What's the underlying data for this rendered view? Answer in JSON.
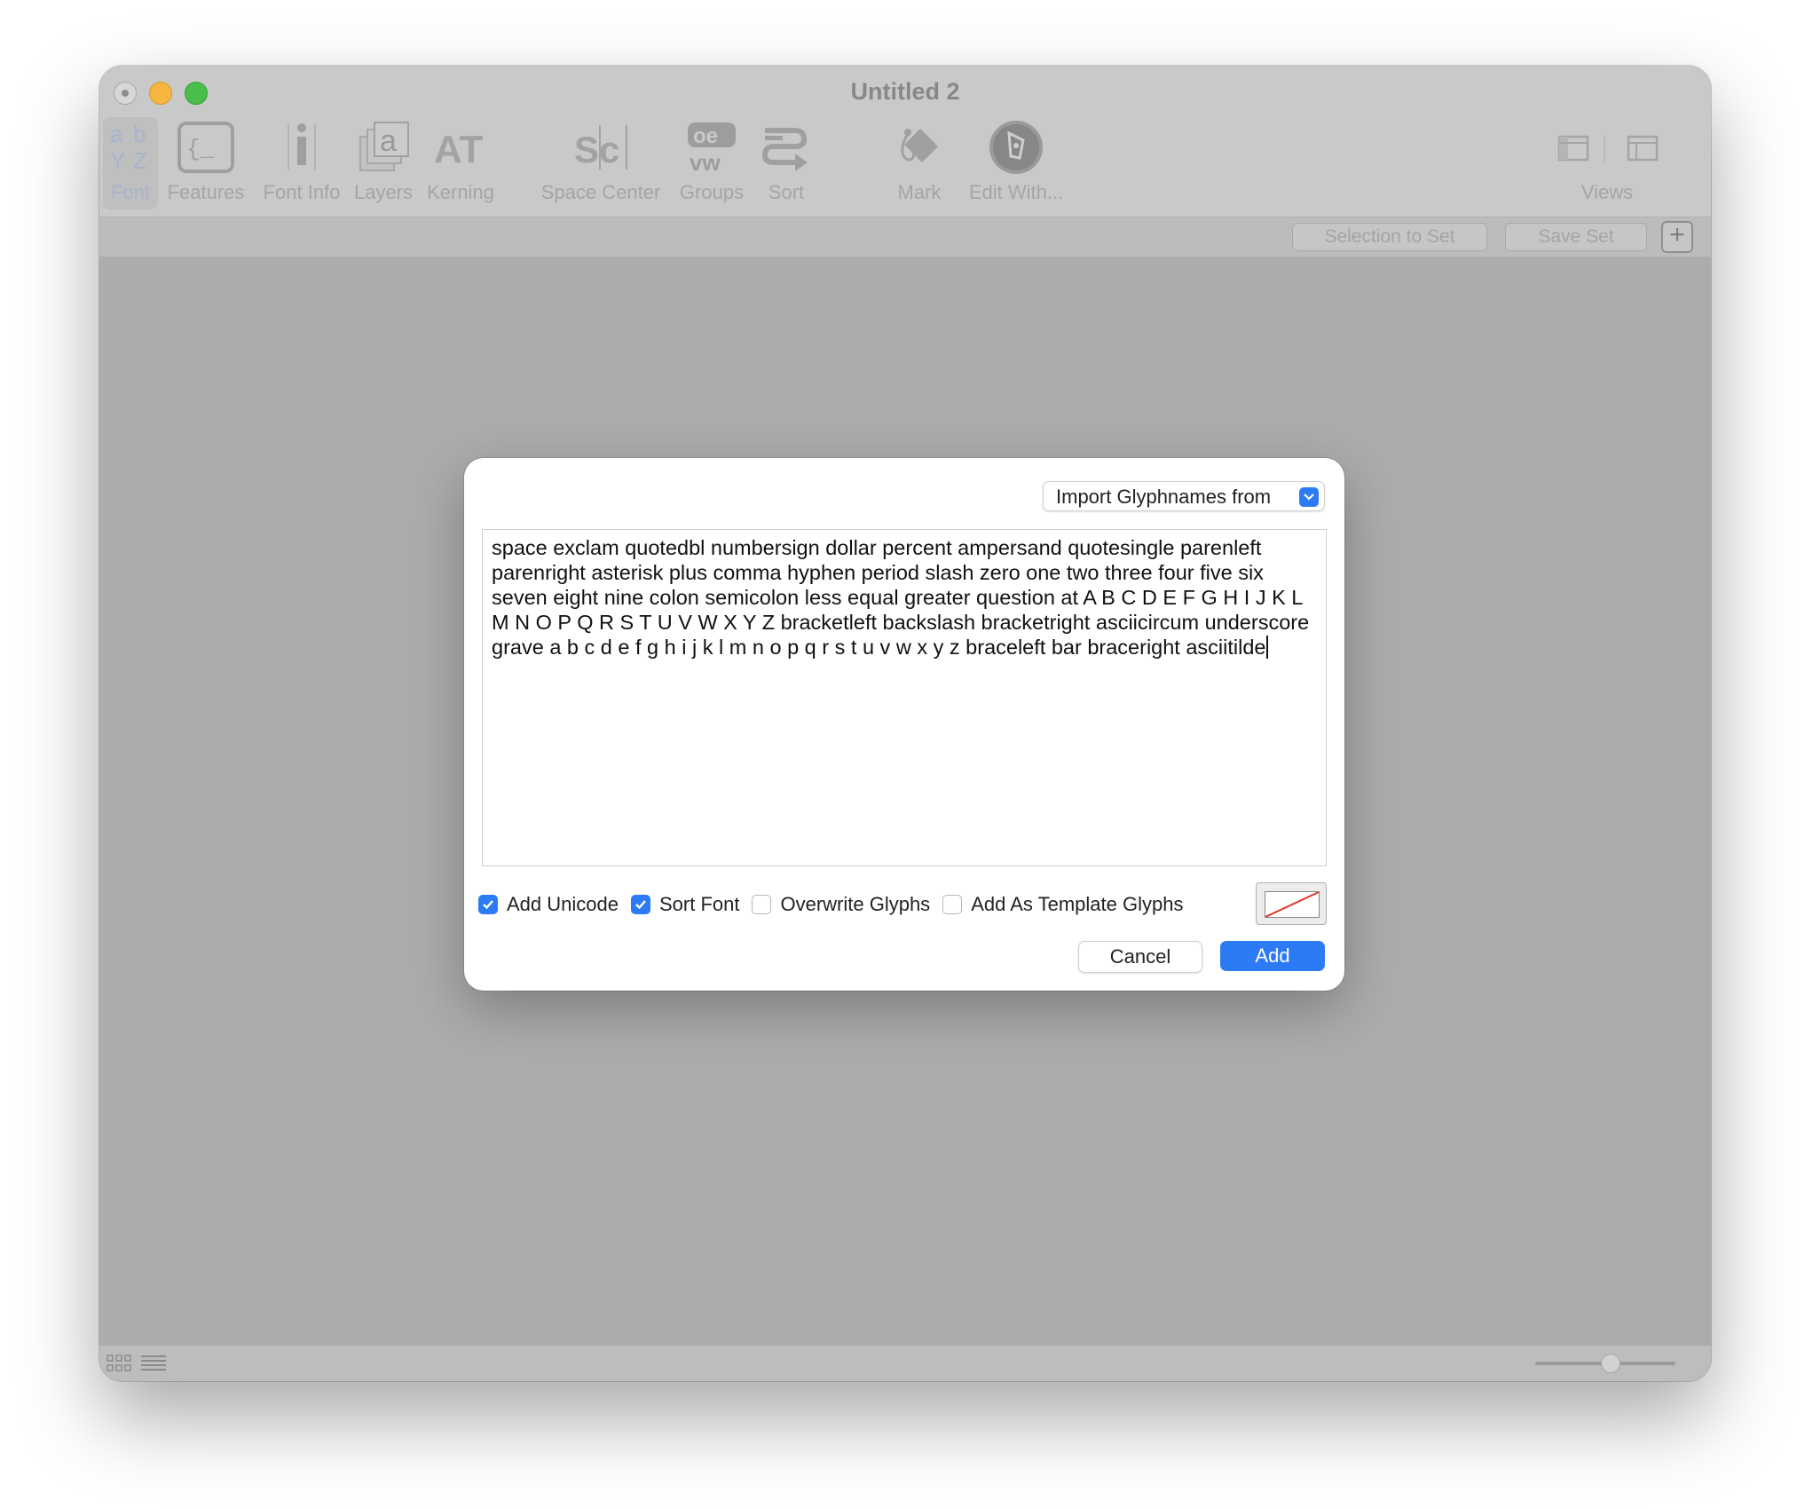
{
  "window": {
    "title": "Untitled 2"
  },
  "toolbar": {
    "items": [
      {
        "label": "Font",
        "icon": "font-overview-icon"
      },
      {
        "label": "Features",
        "icon": "features-icon"
      },
      {
        "label": "Font Info",
        "icon": "font-info-icon"
      },
      {
        "label": "Layers",
        "icon": "layers-icon"
      },
      {
        "label": "Kerning",
        "icon": "kerning-icon"
      },
      {
        "label": "Space Center",
        "icon": "space-center-icon"
      },
      {
        "label": "Groups",
        "icon": "groups-icon"
      },
      {
        "label": "Sort",
        "icon": "sort-icon"
      },
      {
        "label": "Mark",
        "icon": "mark-icon"
      },
      {
        "label": "Edit With...",
        "icon": "edit-with-icon"
      },
      {
        "label": "Views",
        "icon": "views-icon"
      }
    ]
  },
  "setbar": {
    "selection_to_set": "Selection to Set",
    "save_set": "Save Set",
    "add": "+"
  },
  "dialog": {
    "import_label": "Import Glyphnames from",
    "glyph_text": "space exclam quotedbl numbersign dollar percent ampersand quotesingle parenleft parenright asterisk plus comma hyphen period slash zero one two three four five six seven eight nine colon semicolon less equal greater question at A B C D E F G H I J K L M N O P Q R S T U V W X Y Z bracketleft backslash bracketright asciicircum underscore grave a b c d e f g h i j k l m n o p q r s t u v w x y z braceleft bar braceright asciitilde",
    "options": [
      {
        "label": "Add Unicode",
        "checked": true
      },
      {
        "label": "Sort Font",
        "checked": true
      },
      {
        "label": "Overwrite Glyphs",
        "checked": false
      },
      {
        "label": "Add As Template Glyphs",
        "checked": false
      }
    ],
    "cancel_label": "Cancel",
    "add_label": "Add"
  },
  "colors": {
    "accent": "#2d7bf4",
    "window_bg": "#acacac"
  }
}
